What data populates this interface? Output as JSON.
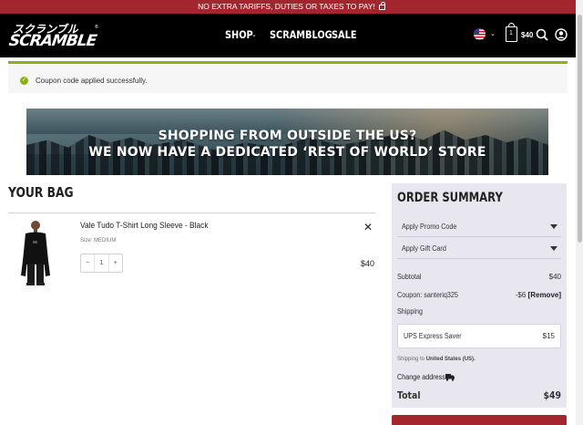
{
  "promo_bar": {
    "text": "NO EXTRA TARIFFS, DUTIES OR TAXES TO PAY!"
  },
  "header": {
    "logo_text": "SCRAMBLE",
    "logo_jp": "スクランブル",
    "nav": [
      {
        "label": "SHOP"
      },
      {
        "label": "SCRAMBLOG"
      },
      {
        "label": "SALE"
      }
    ],
    "cart_count": "1",
    "cart_total": "$40",
    "accent_color": "#a3262f"
  },
  "notice": {
    "text": "Coupon code applied successfully."
  },
  "banner": {
    "line1": "SHOPPING FROM OUTSIDE THE US?",
    "line2": "WE NOW HAVE A DEDICATED ‘REST OF WORLD’ STORE"
  },
  "bag": {
    "title": "YOUR BAG",
    "items": [
      {
        "name": "Vale Tudo T-Shirt Long Sleeve - Black",
        "size": "Size: MEDIUM",
        "qty": "1",
        "price": "$40"
      }
    ]
  },
  "summary": {
    "title": "ORDER SUMMARY",
    "promo_label": "Apply Promo Code",
    "gift_label": "Apply Gift Card",
    "subtotal_label": "Subtotal",
    "subtotal_value": "$40",
    "coupon_label": "Coupon: santeriq325",
    "coupon_value": "-$6",
    "coupon_remove": "[Remove]",
    "shipping_label": "Shipping",
    "shipping_method": "UPS Express Saver",
    "shipping_price": "$15",
    "shipping_to_prefix": "Shipping to",
    "shipping_to_country": "United States (US).",
    "change_address": "Change address",
    "total_label": "Total",
    "total_value": "$49"
  }
}
